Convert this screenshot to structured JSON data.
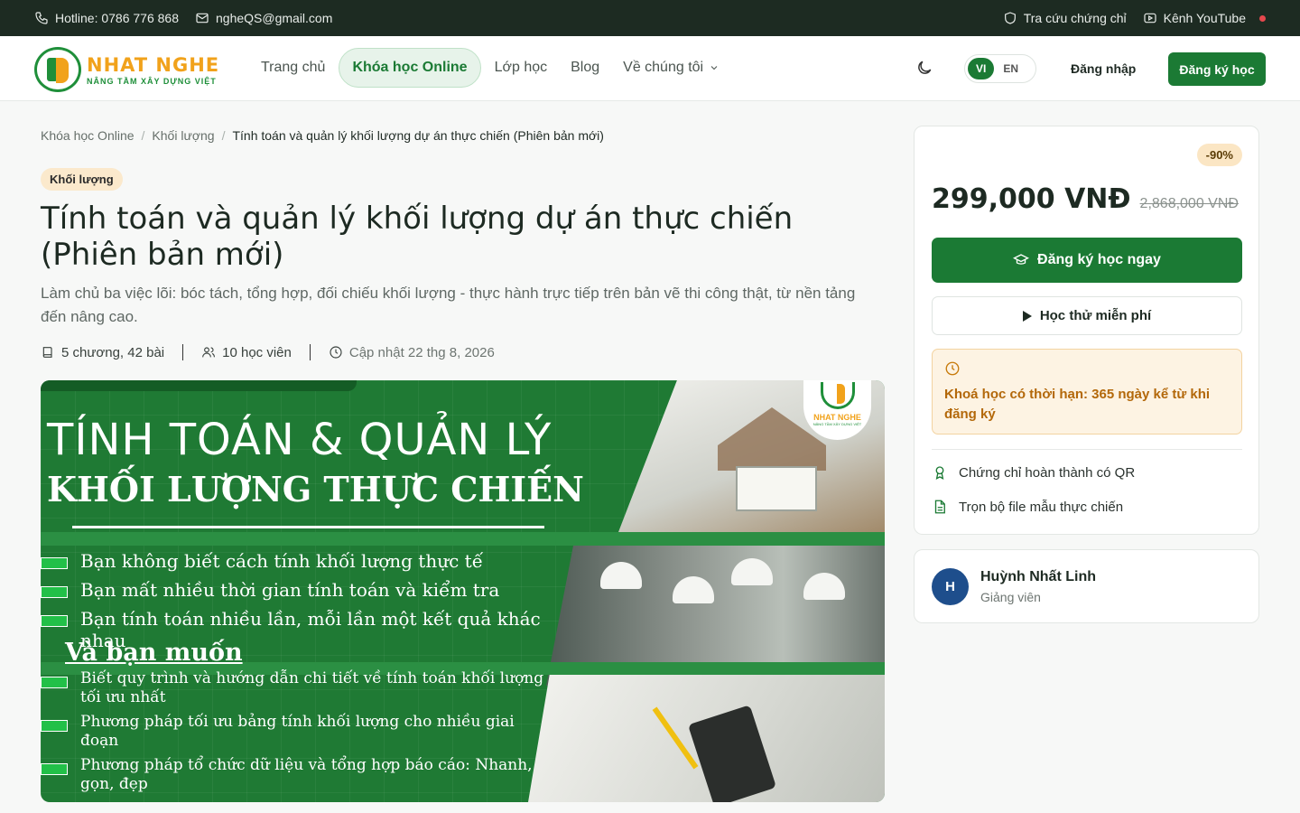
{
  "topbar": {
    "hotline": "Hotline: 0786 776 868",
    "email": "ngheQS@gmail.com",
    "certificate_lookup": "Tra cứu chứng chỉ",
    "youtube": "Kênh YouTube"
  },
  "brand": {
    "name": "NHAT NGHE",
    "tagline": "NÂNG TẦM XÂY DỰNG VIỆT",
    "primary_color": "#1b7a34",
    "accent_color": "#f1a21b"
  },
  "nav": {
    "items": [
      {
        "label": "Trang chủ",
        "active": false
      },
      {
        "label": "Khóa học Online",
        "active": true
      },
      {
        "label": "Lớp học",
        "active": false
      },
      {
        "label": "Blog",
        "active": false
      },
      {
        "label": "Về chúng tôi",
        "active": false,
        "dropdown": true
      }
    ],
    "lang_active": "VI",
    "lang_other": "EN",
    "login": "Đăng nhập",
    "signup": "Đăng ký học"
  },
  "breadcrumb": [
    "Khóa học Online",
    "Khối lượng",
    "Tính toán và quản lý khối lượng dự án thực chiến (Phiên bản mới)"
  ],
  "course": {
    "category": "Khối lượng",
    "title": "Tính toán và quản lý khối lượng dự án thực chiến (Phiên bản mới)",
    "description": "Làm chủ ba việc lõi: bóc tách, tổng hợp, đối chiếu khối lượng - thực hành trực tiếp trên bản vẽ thi công thật, từ nền tảng đến nâng cao.",
    "lessons": "5 chương, 42 bài",
    "students": "10 học viên",
    "updated": "Cập nhật 22 thg 8, 2026"
  },
  "banner": {
    "heading1": "TÍNH TOÁN & QUẢN LÝ",
    "heading2": "KHỐI LƯỢNG THỰC CHIẾN",
    "pains": [
      "Bạn không biết cách tính khối lượng thực tế",
      "Bạn mất nhiều thời gian tính toán và kiểm tra",
      "Bạn tính toán nhiều lần, mỗi lần một kết quả khác nhau"
    ],
    "want_title": "Và bạn muốn",
    "wants": [
      "Biết quy trình và hướng dẫn chi tiết về tính toán khối lượng tối ưu nhất",
      "Phương pháp tối ưu bảng tính khối lượng cho nhiều giai đoạn",
      "Phương pháp tổ chức dữ liệu và tổng hợp báo cáo: Nhanh, gọn, đẹp"
    ],
    "logo_text": "NHAT NGHE",
    "logo_sub": "NÂNG TẦM XÂY DỰNG VIỆT"
  },
  "pricing": {
    "discount": "-90%",
    "price": "299,000 VNĐ",
    "old_price": "2,868,000 VNĐ",
    "enroll": "Đăng ký học ngay",
    "trial": "Học thử miễn phí",
    "limit": "Khoá học có thời hạn: 365 ngày kể từ khi đăng ký",
    "features": [
      "Chứng chỉ hoàn thành có QR",
      "Trọn bộ file mẫu thực chiến"
    ]
  },
  "instructor": {
    "initial": "H",
    "name": "Huỳnh Nhất Linh",
    "role": "Giảng viên"
  }
}
